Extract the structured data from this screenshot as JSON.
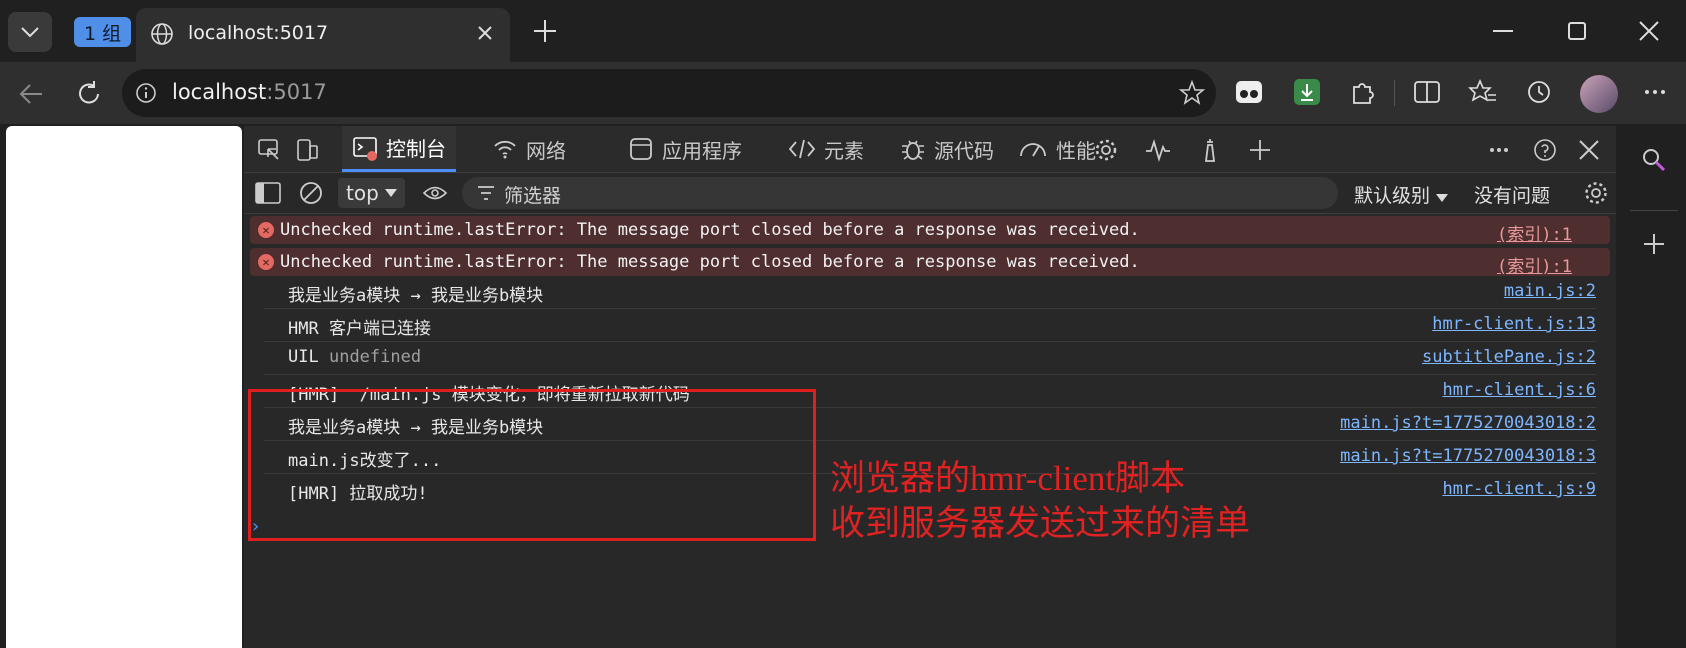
{
  "browser": {
    "tab_group_label": "1 组",
    "tab_title": "localhost:5017",
    "url_host": "localhost",
    "url_port": ":5017"
  },
  "devtools": {
    "tabs": [
      "控制台",
      "网络",
      "应用程序",
      "元素",
      "源代码",
      "性能"
    ],
    "context": "top",
    "filter_placeholder": "筛选器",
    "levels_label": "默认级别",
    "issues_label": "没有问题",
    "messages": [
      {
        "type": "error",
        "text": "Unchecked runtime.lastError: The message port closed before a response was received.",
        "source": "(索引):1"
      },
      {
        "type": "error",
        "text": "Unchecked runtime.lastError: The message port closed before a response was received.",
        "source": "(索引):1"
      },
      {
        "type": "log",
        "text": "我是业务a模块 → 我是业务b模块",
        "source": "main.js:2"
      },
      {
        "type": "log",
        "text": "HMR 客户端已连接",
        "source": "hmr-client.js:13"
      },
      {
        "type": "log",
        "text": "UIL",
        "extra": "undefined",
        "source": "subtitlePane.js:2"
      },
      {
        "type": "log",
        "text": "[HMR]  /main.js 模块变化，即将重新拉取新代码",
        "source": "hmr-client.js:6"
      },
      {
        "type": "log",
        "text": "我是业务a模块 → 我是业务b模块",
        "source": "main.js?t=1775270043018:2"
      },
      {
        "type": "log",
        "text": "main.js改变了...",
        "source": "main.js?t=1775270043018:3"
      },
      {
        "type": "log",
        "text": "[HMR] 拉取成功!",
        "source": "hmr-client.js:9"
      }
    ],
    "prompt": "›"
  },
  "annotation": {
    "line1": "浏览器的hmr-client脚本",
    "line2": "收到服务器发送过来的清单",
    "color": "#e02020"
  },
  "colors": {
    "accent": "#4c8df6",
    "error_bg": "#4e2e2e",
    "link": "#7eb6ff"
  }
}
